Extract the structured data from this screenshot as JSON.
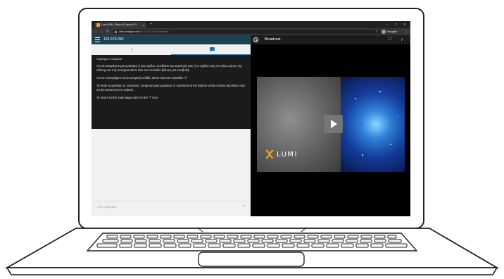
{
  "browser": {
    "tab_title": "Lumi AGM - Bank of Cyprus 4/1",
    "new_tab": "+",
    "url_host": "web.lumiagm.com",
    "url_path": "/#/132-679-260/messages",
    "profile_label": "Incognito"
  },
  "chat_panel": {
    "meeting_id": "132-679-260",
    "message_title": "Πρόεδρος / Chairman",
    "paragraphs": [
      "Για να εισαγάγετε μια ερώτηση ή ένα σχόλιο, συνθέστε την ερώτησή σας ή το σχόλιό σας στο κάτω μέρος της οθόνης και στη συνέχεια κάντε κλικ στο εικονίδιο βέλους για υποβολή.",
      "Για να επιστρέψετε στην κεντρική σελίδα, κάντε κλικ στο εικονίδιο \"i\".",
      "To enter a question or comment, compose your question or comment at the bottom of the screen and then click on the arrow icon to submit.",
      "To return to the main page click on the \"i\" icon."
    ],
    "ask_placeholder": "Ask a question"
  },
  "broadcast": {
    "title": "Broadcast",
    "logo_text": "LUMI"
  },
  "colors": {
    "header_bg": "#1d4052",
    "chat_accent": "#1d6fa5",
    "message_bg": "#1b1b1b",
    "lumi_orange": "#f4a21a"
  }
}
